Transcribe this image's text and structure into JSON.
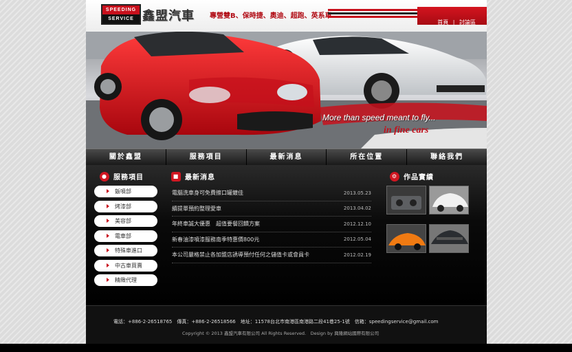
{
  "header": {
    "logo_top": "SPEEDING",
    "logo_bottom": "SERVICE",
    "brand": "鑫盟汽車",
    "slogan": "專營雙B、保時捷、奧迪、超跑、英系車",
    "links": [
      "首頁",
      "|",
      "討論區"
    ]
  },
  "banner": {
    "tagline": "More than speed meant to fly...",
    "tagline_red": "in fine cars"
  },
  "nav": {
    "items": [
      "關於鑫盟",
      "服務項目",
      "最新消息",
      "所在位置",
      "聯絡我們"
    ]
  },
  "services": {
    "title": "服務項目",
    "items": [
      "鈑噴部",
      "烤漆部",
      "美容部",
      "電車部",
      "特殊車進口",
      "中古車買賣",
      "精緻代理"
    ]
  },
  "news": {
    "title": "最新消息",
    "items": [
      {
        "text": "電腦洗車身可免費擦口罐鍍佳",
        "date": "2013.05.23"
      },
      {
        "text": "續提單預約整理愛車",
        "date": "2013.04.02"
      },
      {
        "text": "年終車誠大優惠　超值要餐回饋方案",
        "date": "2012.12.10"
      },
      {
        "text": "新春油漆噴漆服務南季特惠價800元",
        "date": "2012.05.04"
      },
      {
        "text": "本公司嚴格禁止各加盟店誘導預付任何之儲值卡或會員卡",
        "date": "2012.02.19"
      }
    ]
  },
  "works": {
    "title": "作品實績"
  },
  "footer": {
    "line1": "電話：+886-2-26518765　傳真：+886-2-26518566　地址：11578台北市南港區南港路二段41巷25-1號　信箱：speedingservice@gmail.com",
    "line2": "Copyright © 2013 鑫盟汽車有限公司 All Rights Reserved.　Design by 興隆網站國際有限公司"
  },
  "colors": {
    "accent": "#c8101c",
    "background": "#111111"
  }
}
